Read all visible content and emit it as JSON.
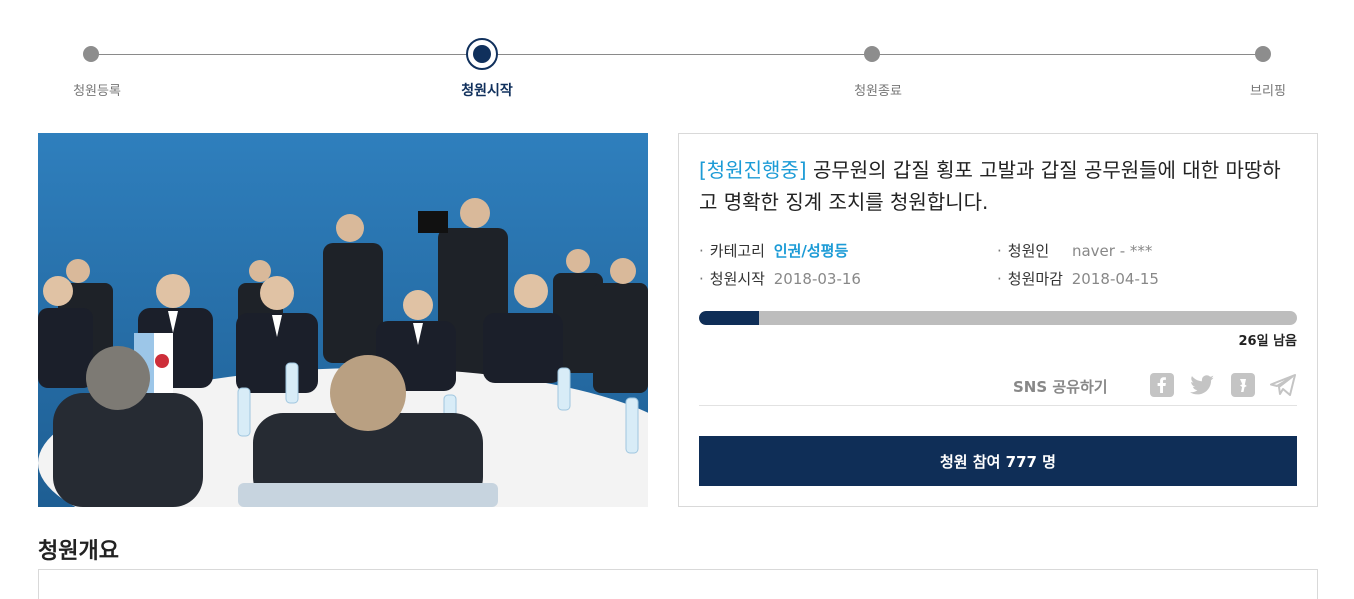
{
  "steps": [
    {
      "label": "청원등록",
      "active": false
    },
    {
      "label": "청원시작",
      "active": true
    },
    {
      "label": "청원종료",
      "active": false
    },
    {
      "label": "브리핑",
      "active": false
    }
  ],
  "petition": {
    "status": "[청원진행중]",
    "title": " 공무원의 갑질 횡포 고발과 갑질 공무원들에 대한 마땅하고 명확한 징계 조치를 청원합니다.",
    "category_label": "카테고리",
    "category_value": "인권/성평등",
    "petitioner_label": "청원인",
    "petitioner_value": "naver - ***",
    "start_label": "청원시작",
    "start_value": "2018-03-16",
    "end_label": "청원마감",
    "end_value": "2018-04-15",
    "progress_fraction": 0.1,
    "remaining": "26일 남음",
    "sns_label": "SNS 공유하기",
    "join_button": "청원 참여 777 명"
  },
  "sns_icons": [
    "facebook-icon",
    "twitter-icon",
    "kakaostory-icon",
    "telegram-icon"
  ],
  "section": {
    "title": "청원개요"
  },
  "colors": {
    "navy": "#0f2e57",
    "accent_blue": "#1c9bd6",
    "gray_dot": "#8d8d8d"
  }
}
